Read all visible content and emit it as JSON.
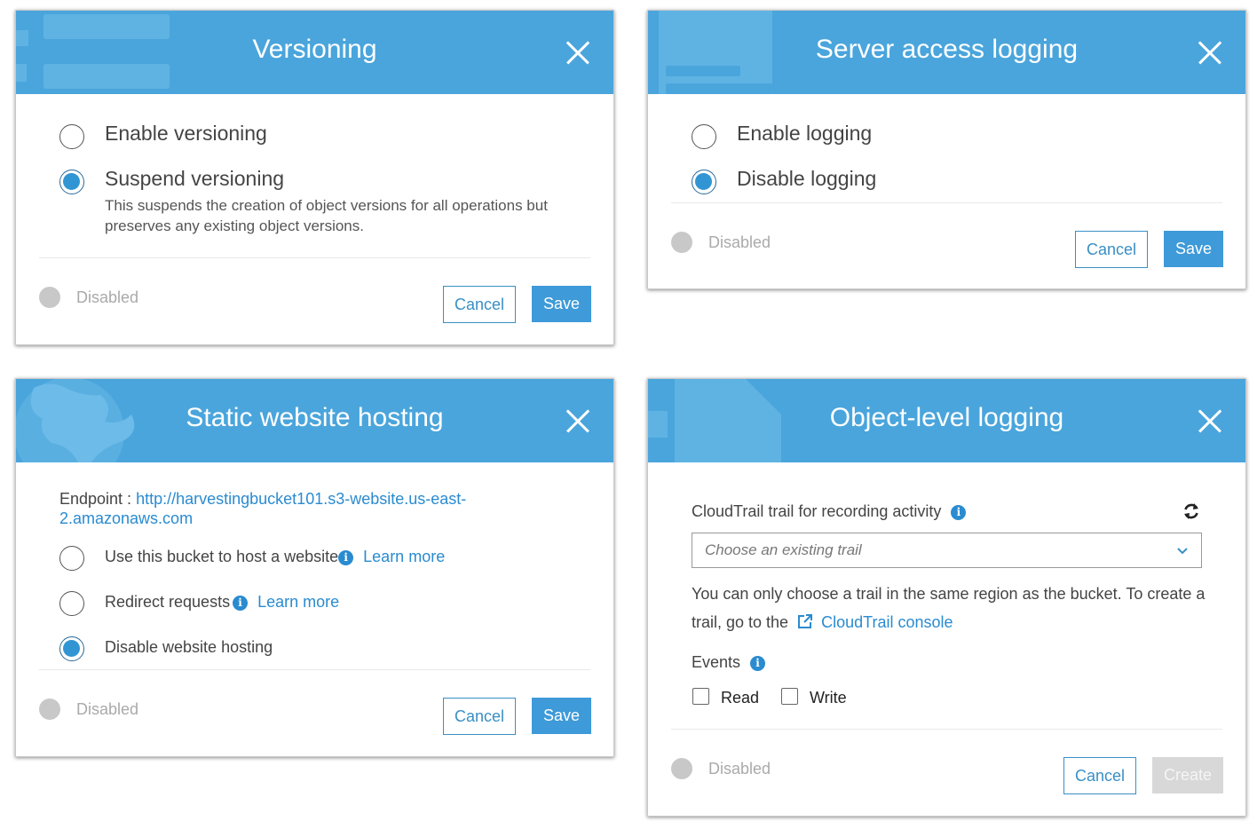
{
  "versioning": {
    "title": "Versioning",
    "options": [
      {
        "label": "Enable versioning",
        "selected": false
      },
      {
        "label": "Suspend versioning",
        "selected": true
      }
    ],
    "description": "This suspends the creation of object versions for all operations but preserves any existing object versions.",
    "status": "Disabled",
    "cancel": "Cancel",
    "save": "Save"
  },
  "server_logging": {
    "title": "Server access logging",
    "options": [
      {
        "label": "Enable logging",
        "selected": false
      },
      {
        "label": "Disable logging",
        "selected": true
      }
    ],
    "status": "Disabled",
    "cancel": "Cancel",
    "save": "Save"
  },
  "static_hosting": {
    "title": "Static website hosting",
    "endpoint_label": "Endpoint :",
    "endpoint_url_line1": "http://harvestingbucket101.s3-website.us-east-",
    "endpoint_url_line2": "2.amazonaws.com",
    "options": [
      {
        "label": "Use this bucket to host a website",
        "selected": false,
        "learn_more": "Learn more"
      },
      {
        "label": "Redirect requests",
        "selected": false,
        "learn_more": "Learn more"
      },
      {
        "label": "Disable website hosting",
        "selected": true
      }
    ],
    "status": "Disabled",
    "cancel": "Cancel",
    "save": "Save"
  },
  "object_logging": {
    "title": "Object-level logging",
    "trail_label": "CloudTrail trail for recording activity",
    "trail_placeholder": "Choose an existing trail",
    "help_text": "You can only choose a trail in the same region as the bucket. To create a trail, go to the",
    "help_line1": "You can only choose a trail in the same region as the bucket. To create a",
    "help_line2": "trail, go to the",
    "console_link": "CloudTrail console",
    "events_label": "Events",
    "events": [
      {
        "label": "Read",
        "checked": false
      },
      {
        "label": "Write",
        "checked": false
      }
    ],
    "status": "Disabled",
    "cancel": "Cancel",
    "create": "Create"
  },
  "icons": {
    "close": "close-icon",
    "info": "info-icon",
    "refresh": "refresh-icon",
    "chevron": "chevron-down-icon",
    "external": "external-link-icon"
  },
  "colors": {
    "header": "#4aa5dc",
    "accent": "#3295d3",
    "link": "#2a8bd0",
    "disabled_button": "#d8d8d8"
  }
}
